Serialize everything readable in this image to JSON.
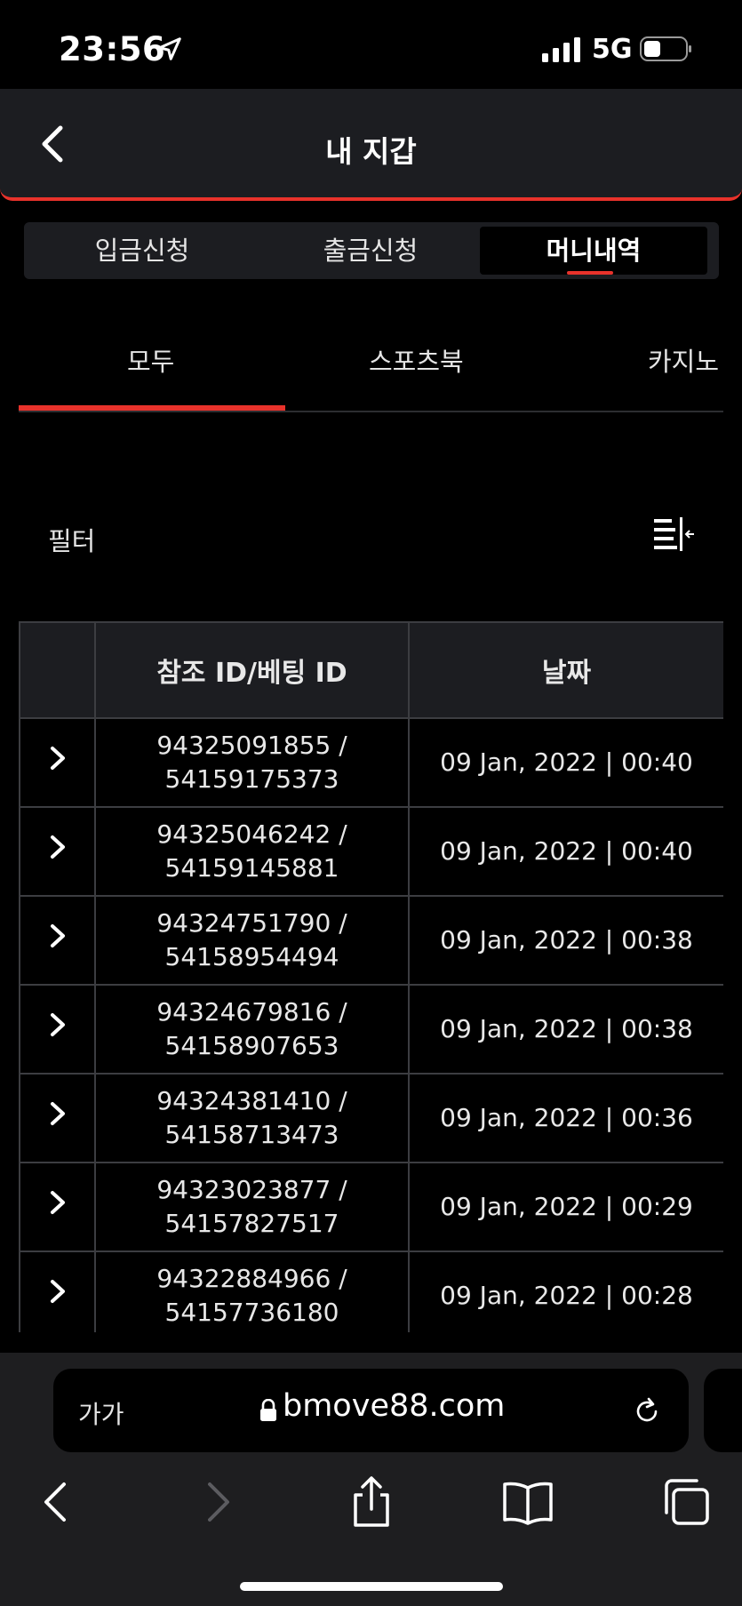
{
  "status": {
    "time": "23:56",
    "network": "5G"
  },
  "header": {
    "title": "내 지갑"
  },
  "segment_tabs": [
    {
      "label": "입금신청",
      "active": false
    },
    {
      "label": "출금신청",
      "active": false
    },
    {
      "label": "머니내역",
      "active": true
    }
  ],
  "sub_tabs": [
    {
      "label": "모두",
      "active": true
    },
    {
      "label": "스포츠북",
      "active": false
    },
    {
      "label": "카지노",
      "active": false
    }
  ],
  "filter": {
    "label": "필터"
  },
  "table": {
    "columns": [
      "",
      "참조 ID/베팅 ID",
      "날짜"
    ],
    "rows": [
      {
        "ref_id": "94325091855 /",
        "bet_id": "54159175373",
        "date": "09 Jan, 2022 | 00:40"
      },
      {
        "ref_id": "94325046242 /",
        "bet_id": "54159145881",
        "date": "09 Jan, 2022 | 00:40"
      },
      {
        "ref_id": "94324751790 /",
        "bet_id": "54158954494",
        "date": "09 Jan, 2022 | 00:38"
      },
      {
        "ref_id": "94324679816 /",
        "bet_id": "54158907653",
        "date": "09 Jan, 2022 | 00:38"
      },
      {
        "ref_id": "94324381410 /",
        "bet_id": "54158713473",
        "date": "09 Jan, 2022 | 00:36"
      },
      {
        "ref_id": "94323023877 /",
        "bet_id": "54157827517",
        "date": "09 Jan, 2022 | 00:29"
      },
      {
        "ref_id": "94322884966 /",
        "bet_id": "54157736180",
        "date": "09 Jan, 2022 | 00:28"
      }
    ]
  },
  "browser": {
    "aa_label": "가가",
    "url": "bmove88.com"
  },
  "colors": {
    "accent": "#e8322b",
    "panel": "#1c1d21",
    "background": "#000000"
  }
}
